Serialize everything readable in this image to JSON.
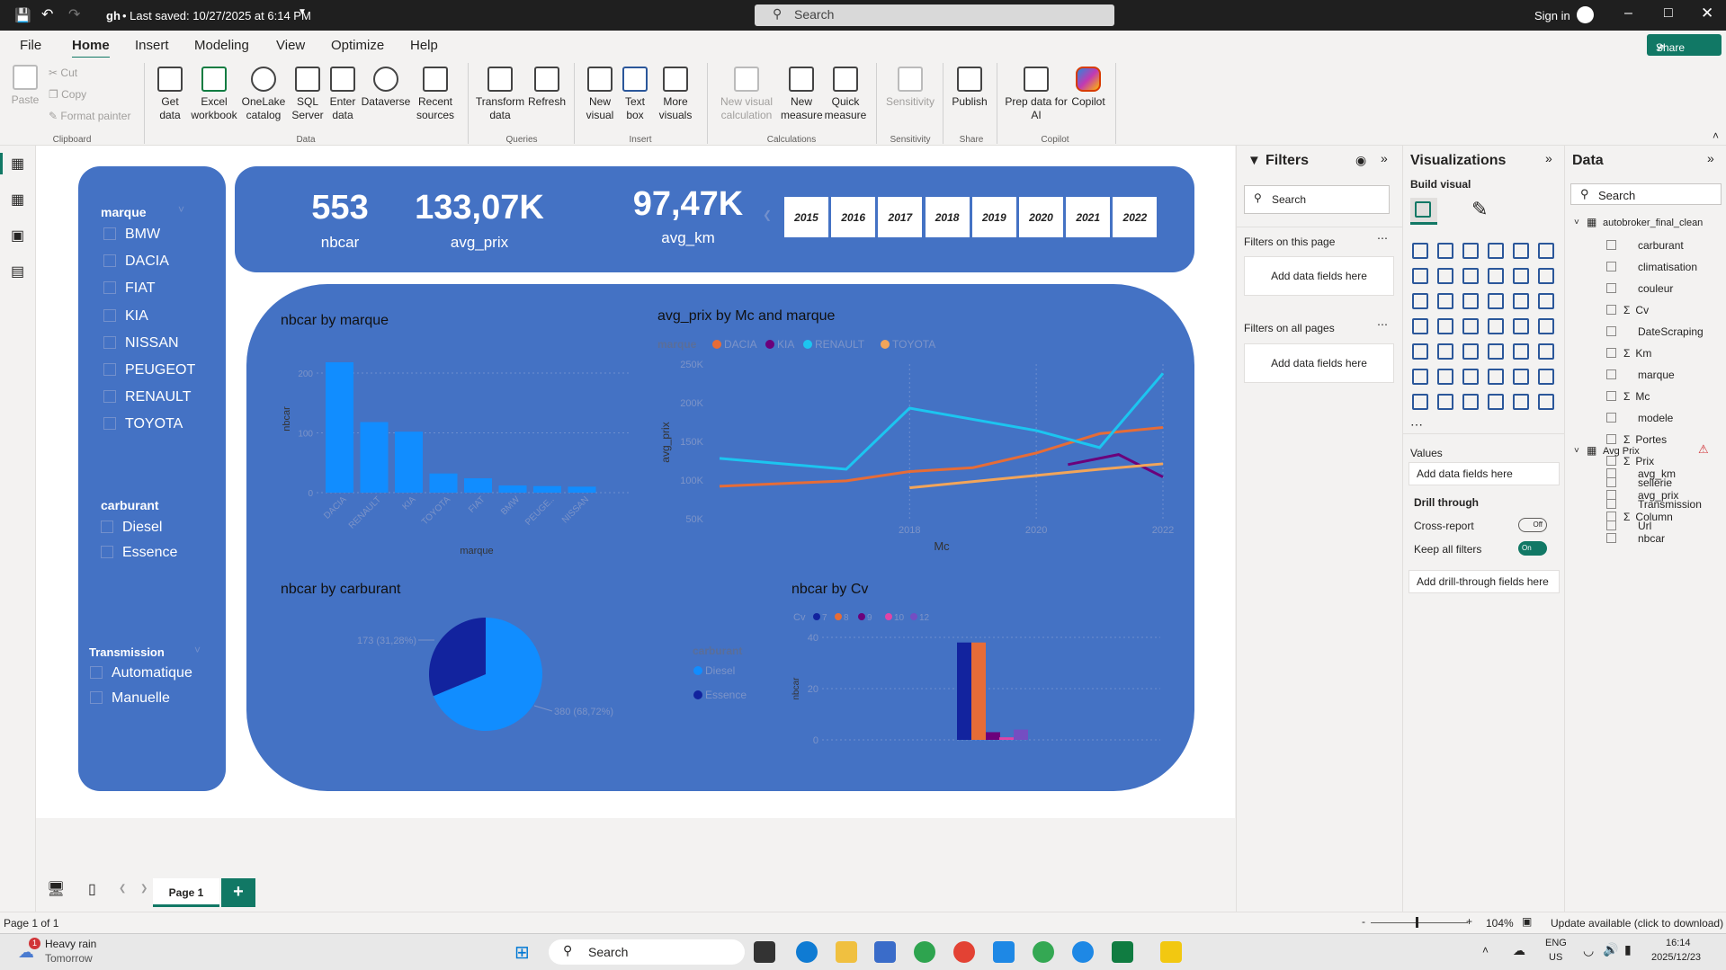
{
  "titlebar": {
    "doc_title": "gh",
    "saved": "• Last saved: 10/27/2025 at 6:14 PM",
    "search": "Search",
    "signin": "Sign in"
  },
  "menu": {
    "file": "File",
    "home": "Home",
    "insert": "Insert",
    "modeling": "Modeling",
    "view": "View",
    "optimize": "Optimize",
    "help": "Help",
    "share": "Share"
  },
  "ribbon": {
    "paste": "Paste",
    "cut": "Cut",
    "copy": "Copy",
    "format_painter": "Format painter",
    "clipboard": "Clipboard",
    "get_data": "Get data",
    "excel": "Excel workbook",
    "onelake": "OneLake catalog",
    "sql": "SQL Server",
    "enter_data": "Enter data",
    "dataverse": "Dataverse",
    "recent": "Recent sources",
    "data_group": "Data",
    "transform": "Transform data",
    "refresh": "Refresh",
    "queries": "Queries",
    "new_visual": "New visual",
    "text_box": "Text box",
    "more_visuals": "More visuals",
    "insert_group": "Insert",
    "new_calc": "New visual calculation",
    "new_measure": "New measure",
    "quick_measure": "Quick measure",
    "calculations": "Calculations",
    "sensitivity_btn": "Sensitivity",
    "sensitivity": "Sensitivity",
    "publish": "Publish",
    "share_group": "Share",
    "prep_ai": "Prep data for AI",
    "copilot_btn": "Copilot",
    "copilot": "Copilot"
  },
  "slicers": {
    "marque_title": "marque",
    "marques": [
      "BMW",
      "DACIA",
      "FIAT",
      "KIA",
      "NISSAN",
      "PEUGEOT",
      "RENAULT",
      "TOYOTA"
    ],
    "carburant_title": "carburant",
    "carburants": [
      "Diesel",
      "Essence"
    ],
    "transmission_title": "Transmission",
    "transmissions": [
      "Automatique",
      "Manuelle"
    ]
  },
  "kpis": {
    "nbcar_value": "553",
    "nbcar_label": "nbcar",
    "avg_prix_value": "133,07K",
    "avg_prix_label": "avg_prix",
    "avg_km_value": "97,47K",
    "avg_km_label": "avg_km"
  },
  "years": [
    "2015",
    "2016",
    "2017",
    "2018",
    "2019",
    "2020",
    "2021",
    "2022"
  ],
  "colors": {
    "bar": "#118dff",
    "dacia": "#e66c37",
    "kia": "#6b007b",
    "renault": "#1cc5f0",
    "toyota": "#f2a55a",
    "diesel": "#118dff",
    "essence": "#12239e",
    "panel": "#4472c4"
  },
  "chart_data": [
    {
      "type": "bar",
      "title": "nbcar by marque",
      "xlabel": "marque",
      "ylabel": "nbcar",
      "categories": [
        "DACIA",
        "RENAULT",
        "KIA",
        "TOYOTA",
        "FIAT",
        "BMW",
        "PEUGE..",
        "NISSAN"
      ],
      "values": [
        218,
        118,
        102,
        32,
        24,
        12,
        11,
        10
      ],
      "yticks": [
        "0",
        "100",
        "200"
      ],
      "ylim": [
        0,
        230
      ]
    },
    {
      "type": "line",
      "title": "avg_prix by Mc and marque",
      "xlabel": "Mc",
      "ylabel": "avg_prix",
      "legend_title": "marque",
      "x": [
        2015,
        2016,
        2017,
        2018,
        2019,
        2020,
        2021,
        2022
      ],
      "xticks": [
        "2018",
        "2020",
        "2022"
      ],
      "yticks": [
        "50K",
        "100K",
        "150K",
        "200K",
        "250K"
      ],
      "ylim": [
        50000,
        250000
      ],
      "series": [
        {
          "name": "DACIA",
          "points": [
            [
              2015.0,
              92000
            ],
            [
              2017.0,
              99000
            ],
            [
              2018.0,
              111000
            ],
            [
              2019.0,
              116000
            ],
            [
              2020.0,
              135000
            ],
            [
              2021.0,
              160000
            ],
            [
              2022.0,
              168000
            ]
          ]
        },
        {
          "name": "KIA",
          "points": [
            [
              2020.5,
              120000
            ],
            [
              2021.3,
              133000
            ],
            [
              2022.0,
              104000
            ]
          ]
        },
        {
          "name": "RENAULT",
          "points": [
            [
              2015.0,
              128000
            ],
            [
              2017.0,
              114000
            ],
            [
              2018.0,
              193000
            ],
            [
              2020.0,
              164000
            ],
            [
              2021.0,
              142000
            ],
            [
              2022.0,
              238000
            ]
          ]
        },
        {
          "name": "TOYOTA",
          "points": [
            [
              2018.0,
              90000
            ],
            [
              2020.0,
              106000
            ],
            [
              2021.0,
              114000
            ],
            [
              2022.0,
              121000
            ]
          ]
        }
      ]
    },
    {
      "type": "pie",
      "title": "nbcar by carburant",
      "legend_title": "carburant",
      "slices": [
        {
          "label": "Diesel",
          "value": 380,
          "text": "380 (68,72%)"
        },
        {
          "label": "Essence",
          "value": 173,
          "text": "173 (31,28%)"
        }
      ]
    },
    {
      "type": "bar",
      "title": "nbcar by Cv",
      "ylabel": "nbcar",
      "legend_title": "Cv",
      "legend": [
        "7",
        "8",
        "9",
        "10",
        "12"
      ],
      "series": [
        {
          "name": "7",
          "value": 38
        },
        {
          "name": "8",
          "value": 38
        },
        {
          "name": "9",
          "value": 3
        },
        {
          "name": "10",
          "value": 1
        },
        {
          "name": "12",
          "value": 4
        }
      ],
      "yticks": [
        "0",
        "20",
        "40"
      ],
      "ylim": [
        0,
        40
      ]
    }
  ],
  "filters": {
    "title": "Filters",
    "search": "Search",
    "this_page": "Filters on this page",
    "all_pages": "Filters on all pages",
    "add_fields": "Add data fields here"
  },
  "visualizations": {
    "title": "Visualizations",
    "build": "Build visual",
    "values": "Values",
    "add_fields": "Add data fields here",
    "drill": "Drill through",
    "cross_report": "Cross-report",
    "cross_state": "Off",
    "keep_filters": "Keep all filters",
    "keep_state": "On",
    "add_drill": "Add drill-through fields here"
  },
  "data_pane": {
    "title": "Data",
    "search": "Search",
    "table1": "autobroker_final_clean",
    "fields1": [
      {
        "name": "carburant",
        "sigma": false
      },
      {
        "name": "climatisation",
        "sigma": false
      },
      {
        "name": "couleur",
        "sigma": false
      },
      {
        "name": "Cv",
        "sigma": true
      },
      {
        "name": "DateScraping",
        "sigma": false
      },
      {
        "name": "Km",
        "sigma": true
      },
      {
        "name": "marque",
        "sigma": false
      },
      {
        "name": "Mc",
        "sigma": true
      },
      {
        "name": "modele",
        "sigma": false
      },
      {
        "name": "Portes",
        "sigma": true
      },
      {
        "name": "Prix",
        "sigma": true
      },
      {
        "name": "sellerie",
        "sigma": false
      },
      {
        "name": "Transmission",
        "sigma": false
      },
      {
        "name": "Url",
        "sigma": false
      }
    ],
    "table2": "Avg Prix",
    "fields2": [
      {
        "name": "avg_km",
        "sigma": false
      },
      {
        "name": "avg_prix",
        "sigma": false
      },
      {
        "name": "Column",
        "sigma": true
      },
      {
        "name": "nbcar",
        "sigma": false
      }
    ]
  },
  "pages": {
    "page1": "Page 1",
    "add": "+"
  },
  "status": {
    "page": "Page 1 of 1",
    "zoom": "104%",
    "update": "Update available (click to download)"
  },
  "taskbar": {
    "weather": "Heavy rain",
    "weather_sub": "Tomorrow",
    "search": "Search",
    "lang": "ENG",
    "region": "US",
    "time": "16:14",
    "date": "2025/12/23"
  }
}
